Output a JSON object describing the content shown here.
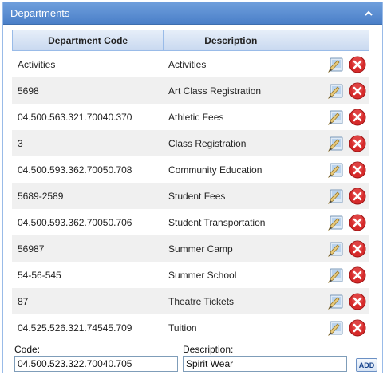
{
  "panel": {
    "title": "Departments"
  },
  "grid": {
    "columns": [
      "Department Code",
      "Description",
      ""
    ],
    "rows": [
      {
        "code": "Activities",
        "description": "Activities"
      },
      {
        "code": "5698",
        "description": "Art Class Registration"
      },
      {
        "code": "04.500.563.321.70040.370",
        "description": "Athletic Fees"
      },
      {
        "code": "3",
        "description": "Class Registration"
      },
      {
        "code": "04.500.593.362.70050.708",
        "description": "Community Education"
      },
      {
        "code": "5689-2589",
        "description": "Student Fees"
      },
      {
        "code": "04.500.593.362.70050.706",
        "description": "Student Transportation"
      },
      {
        "code": "56987",
        "description": "Summer Camp"
      },
      {
        "code": "54-56-545",
        "description": "Summer School"
      },
      {
        "code": "87",
        "description": "Theatre Tickets"
      },
      {
        "code": "04.525.526.321.74545.709",
        "description": "Tuition"
      }
    ]
  },
  "form": {
    "code_label": "Code:",
    "code_value": "04.500.523.322.70040.705",
    "description_label": "Description:",
    "description_value": "Spirit Wear",
    "add_label": "ADD"
  },
  "icons": {
    "edit": "edit-icon",
    "delete": "delete-icon",
    "collapse": "chevron-up-icon"
  },
  "colors": {
    "header": "#4a7fc8",
    "delete": "#d62b2b",
    "border": "#99bbe8"
  }
}
